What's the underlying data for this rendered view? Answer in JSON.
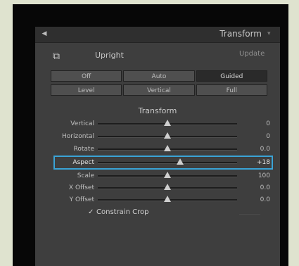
{
  "panel": {
    "title": "Transform",
    "upright_label": "Upright",
    "update_label": "Update",
    "mode_row1": [
      "Off",
      "Auto",
      "Guided"
    ],
    "mode_row2": [
      "Level",
      "Vertical",
      "Full"
    ],
    "active_mode": "Guided",
    "section_label": "Transform",
    "sliders": [
      {
        "label": "Vertical",
        "value": "0",
        "level": 0.5
      },
      {
        "label": "Horizontal",
        "value": "0",
        "level": 0.5
      },
      {
        "label": "Rotate",
        "value": "0.0",
        "level": 0.5
      },
      {
        "label": "Aspect",
        "value": "+18",
        "level": 0.59
      },
      {
        "label": "Scale",
        "value": "100",
        "level": 0.5
      },
      {
        "label": "X Offset",
        "value": "0.0",
        "level": 0.5
      },
      {
        "label": "Y Offset",
        "value": "0.0",
        "level": 0.5
      }
    ],
    "constrain_crop_label": "Constrain Crop",
    "constrain_crop_checked": true
  },
  "colors": {
    "highlight": "#3aa3d6",
    "panel_bg": "#3e3e3e",
    "frame_bg": "#070707",
    "page_bg": "#dfe3cf"
  },
  "icons": {
    "collapse": "triangle-down-icon",
    "upright_tool": "upright-guides-icon",
    "panel_switch": "panel-switch-icon",
    "checkmark": "checkmark-icon"
  }
}
